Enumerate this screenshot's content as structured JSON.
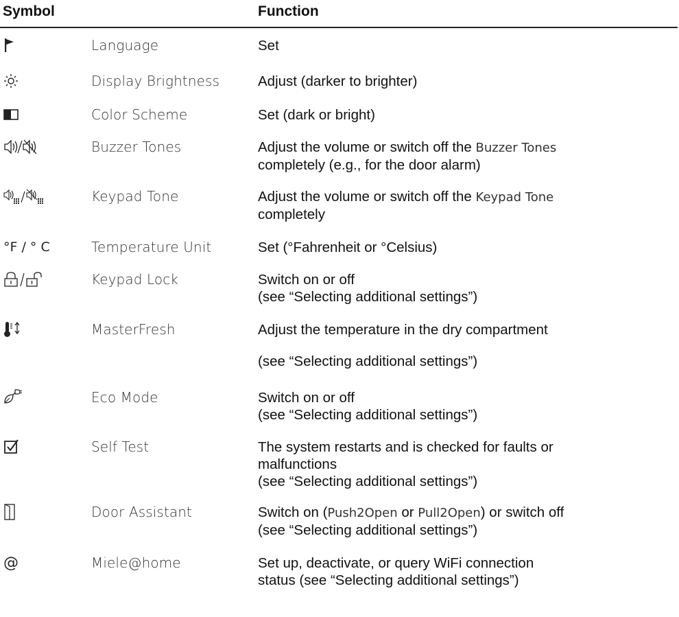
{
  "header": {
    "symbol": "Symbol",
    "function": "Function"
  },
  "rows": [
    {
      "icon": "flag-icon",
      "name": "Language",
      "function": [
        "Set"
      ]
    },
    {
      "icon": "sun-icon",
      "name": "Display Brightness",
      "function": [
        "Adjust (darker to brighter)"
      ]
    },
    {
      "icon": "half-square-icon",
      "name": "Color Scheme",
      "function": [
        "Set (dark or bright)"
      ]
    },
    {
      "icon": "speaker-mute-icon",
      "name": "Buzzer Tones",
      "function_parts": {
        "a": "Adjust the volume or switch off the ",
        "b": "Buzzer Tones",
        "c": "completely (e.g., for the door alarm)"
      }
    },
    {
      "icon": "keypad-speaker-icon",
      "name": "Keypad Tone",
      "function_parts": {
        "a": "Adjust the volume or switch off the ",
        "b": "Keypad Tone",
        "c": "completely"
      }
    },
    {
      "icon": "temperature-unit-icon",
      "icon_text": "°F / ° C",
      "name": "Temperature Unit",
      "function": [
        "Set (°Fahrenheit or °Celsius)"
      ]
    },
    {
      "icon": "lock-unlock-icon",
      "name": "Keypad Lock",
      "function": [
        "Switch on or off",
        "(see “Selecting additional settings”)"
      ]
    },
    {
      "icon": "thermometer-icon",
      "name": "MasterFresh",
      "function": [
        "Adjust the temperature in the dry compartment",
        "(see “Selecting additional settings”)"
      ]
    },
    {
      "icon": "leaf-plug-icon",
      "name": "Eco Mode",
      "function": [
        "Switch on or off",
        "(see “Selecting additional settings”)"
      ]
    },
    {
      "icon": "checkbox-icon",
      "name": "Self Test",
      "function": [
        "The system restarts and is checked for faults or",
        "malfunctions",
        "(see “Selecting additional settings”)"
      ]
    },
    {
      "icon": "door-icon",
      "name": "Door Assistant",
      "function_parts": {
        "a": "Switch on (",
        "b": "Push2Open",
        "c": " or ",
        "d": "Pull2Open",
        "e": ") or switch off",
        "f": "(see “Selecting additional settings”)"
      }
    },
    {
      "icon": "at-icon",
      "icon_text": "@",
      "name": "Miele@home",
      "function": [
        "Set up, deactivate, or query WiFi connection",
        "status (see “Selecting additional settings”)"
      ]
    }
  ]
}
